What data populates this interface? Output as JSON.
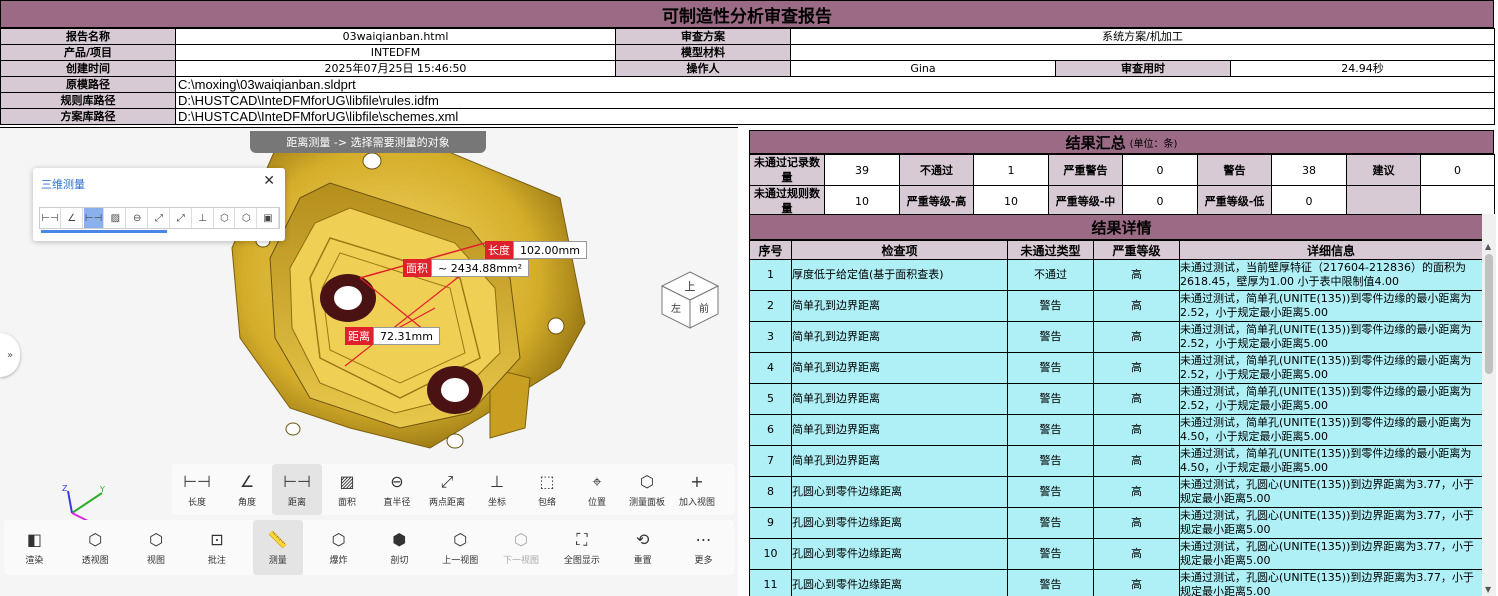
{
  "report": {
    "title": "可制造性分析审查报告"
  },
  "info": {
    "report_name_label": "报告名称",
    "report_name": "03waiqianban.html",
    "scheme_label": "审查方案",
    "scheme": "系统方案/机加工",
    "product_label": "产品/项目",
    "product": "INTEDFM",
    "material_label": "模型材料",
    "material": "",
    "created_label": "创建时间",
    "created": "2025年07月25日 15:46:50",
    "operator_label": "操作人",
    "operator": "Gina",
    "duration_label": "审查用时",
    "duration": "24.94秒",
    "model_path_label": "原模路径",
    "model_path": "C:\\moxing\\03waiqianban.sldprt",
    "rules_path_label": "规则库路径",
    "rules_path": "D:\\HUSTCAD\\InteDFMforUG\\libfile\\rules.idfm",
    "schemes_path_label": "方案库路径",
    "schemes_path": "D:\\HUSTCAD\\InteDFMforUG\\libfile\\schemes.xml"
  },
  "viewer": {
    "hint": "距离测量 -> 选择需要测量的对象",
    "measure_panel_title": "三维测量",
    "close_glyph": "✕",
    "expand_glyph": "»",
    "cube_top": "上",
    "cube_front": "左",
    "cube_right": "前",
    "measurements": [
      {
        "key": "长度",
        "value": "102.00mm"
      },
      {
        "key": "面积",
        "value": "~ 2434.88mm²"
      },
      {
        "key": "距离",
        "value": "72.31mm"
      }
    ],
    "toolbar1": [
      {
        "label": "长度",
        "icon": "⊢⊣"
      },
      {
        "label": "角度",
        "icon": "∠"
      },
      {
        "label": "距离",
        "icon": "⊢⊣"
      },
      {
        "label": "面积",
        "icon": "▨"
      },
      {
        "label": "直半径",
        "icon": "⊖"
      },
      {
        "label": "两点距离",
        "icon": "⤢"
      },
      {
        "label": "坐标",
        "icon": "⊥"
      },
      {
        "label": "包络",
        "icon": "⬚"
      },
      {
        "label": "位置",
        "icon": "⌖"
      },
      {
        "label": "测量面板",
        "icon": "⬡"
      },
      {
        "label": "加入视图",
        "icon": "+"
      }
    ],
    "toolbar2": [
      {
        "label": "渲染",
        "icon": "◧"
      },
      {
        "label": "透视图",
        "icon": "⬡"
      },
      {
        "label": "视图",
        "icon": "⬡"
      },
      {
        "label": "批注",
        "icon": "⊡"
      },
      {
        "label": "测量",
        "icon": "📏"
      },
      {
        "label": "爆炸",
        "icon": "⬡"
      },
      {
        "label": "剖切",
        "icon": "⬢"
      },
      {
        "label": "上一视图",
        "icon": "⬡"
      },
      {
        "label": "下一视图",
        "icon": "⬡"
      },
      {
        "label": "全图显示",
        "icon": "⛶"
      },
      {
        "label": "重置",
        "icon": "⟲"
      },
      {
        "label": "更多",
        "icon": "⋯"
      }
    ]
  },
  "summary": {
    "title": "结果汇总",
    "unit": "(单位：条)",
    "row1": [
      {
        "label": "未通过记录数量",
        "value": "39"
      },
      {
        "label": "不通过",
        "value": "1"
      },
      {
        "label": "严重警告",
        "value": "0"
      },
      {
        "label": "警告",
        "value": "38"
      },
      {
        "label": "建议",
        "value": "0"
      }
    ],
    "row2": [
      {
        "label": "未通过规则数量",
        "value": "10"
      },
      {
        "label": "严重等级-高",
        "value": "10"
      },
      {
        "label": "严重等级-中",
        "value": "0"
      },
      {
        "label": "严重等级-低",
        "value": "0"
      }
    ]
  },
  "details": {
    "title": "结果详情",
    "headers": [
      "序号",
      "检查项",
      "未通过类型",
      "严重等级",
      "详细信息"
    ],
    "rows": [
      {
        "no": "1",
        "item": "厚度低于给定值(基于面积查表)",
        "type": "不通过",
        "level": "高",
        "detail": "未通过测试，当前壁厚特征（217604-212836）的面积为2618.45，壁厚为1.00 小于表中限制值4.00"
      },
      {
        "no": "2",
        "item": "简单孔到边界距离",
        "type": "警告",
        "level": "高",
        "detail": "未通过测试，简单孔(UNITE(135))到零件边缘的最小距离为2.52，小于规定最小距离5.00"
      },
      {
        "no": "3",
        "item": "简单孔到边界距离",
        "type": "警告",
        "level": "高",
        "detail": "未通过测试，简单孔(UNITE(135))到零件边缘的最小距离为2.52，小于规定最小距离5.00"
      },
      {
        "no": "4",
        "item": "简单孔到边界距离",
        "type": "警告",
        "level": "高",
        "detail": "未通过测试，简单孔(UNITE(135))到零件边缘的最小距离为2.52，小于规定最小距离5.00"
      },
      {
        "no": "5",
        "item": "简单孔到边界距离",
        "type": "警告",
        "level": "高",
        "detail": "未通过测试，简单孔(UNITE(135))到零件边缘的最小距离为2.52，小于规定最小距离5.00"
      },
      {
        "no": "6",
        "item": "简单孔到边界距离",
        "type": "警告",
        "level": "高",
        "detail": "未通过测试，简单孔(UNITE(135))到零件边缘的最小距离为4.50，小于规定最小距离5.00"
      },
      {
        "no": "7",
        "item": "简单孔到边界距离",
        "type": "警告",
        "level": "高",
        "detail": "未通过测试，简单孔(UNITE(135))到零件边缘的最小距离为4.50，小于规定最小距离5.00"
      },
      {
        "no": "8",
        "item": "孔圆心到零件边缘距离",
        "type": "警告",
        "level": "高",
        "detail": "未通过测试，孔圆心(UNITE(135))到边界距离为3.77，小于规定最小距离5.00"
      },
      {
        "no": "9",
        "item": "孔圆心到零件边缘距离",
        "type": "警告",
        "level": "高",
        "detail": "未通过测试，孔圆心(UNITE(135))到边界距离为3.77，小于规定最小距离5.00"
      },
      {
        "no": "10",
        "item": "孔圆心到零件边缘距离",
        "type": "警告",
        "level": "高",
        "detail": "未通过测试，孔圆心(UNITE(135))到边界距离为3.77，小于规定最小距离5.00"
      },
      {
        "no": "11",
        "item": "孔圆心到零件边缘距离",
        "type": "警告",
        "level": "高",
        "detail": "未通过测试，孔圆心(UNITE(135))到边界距离为3.77，小于规定最小距离5.00"
      }
    ]
  }
}
